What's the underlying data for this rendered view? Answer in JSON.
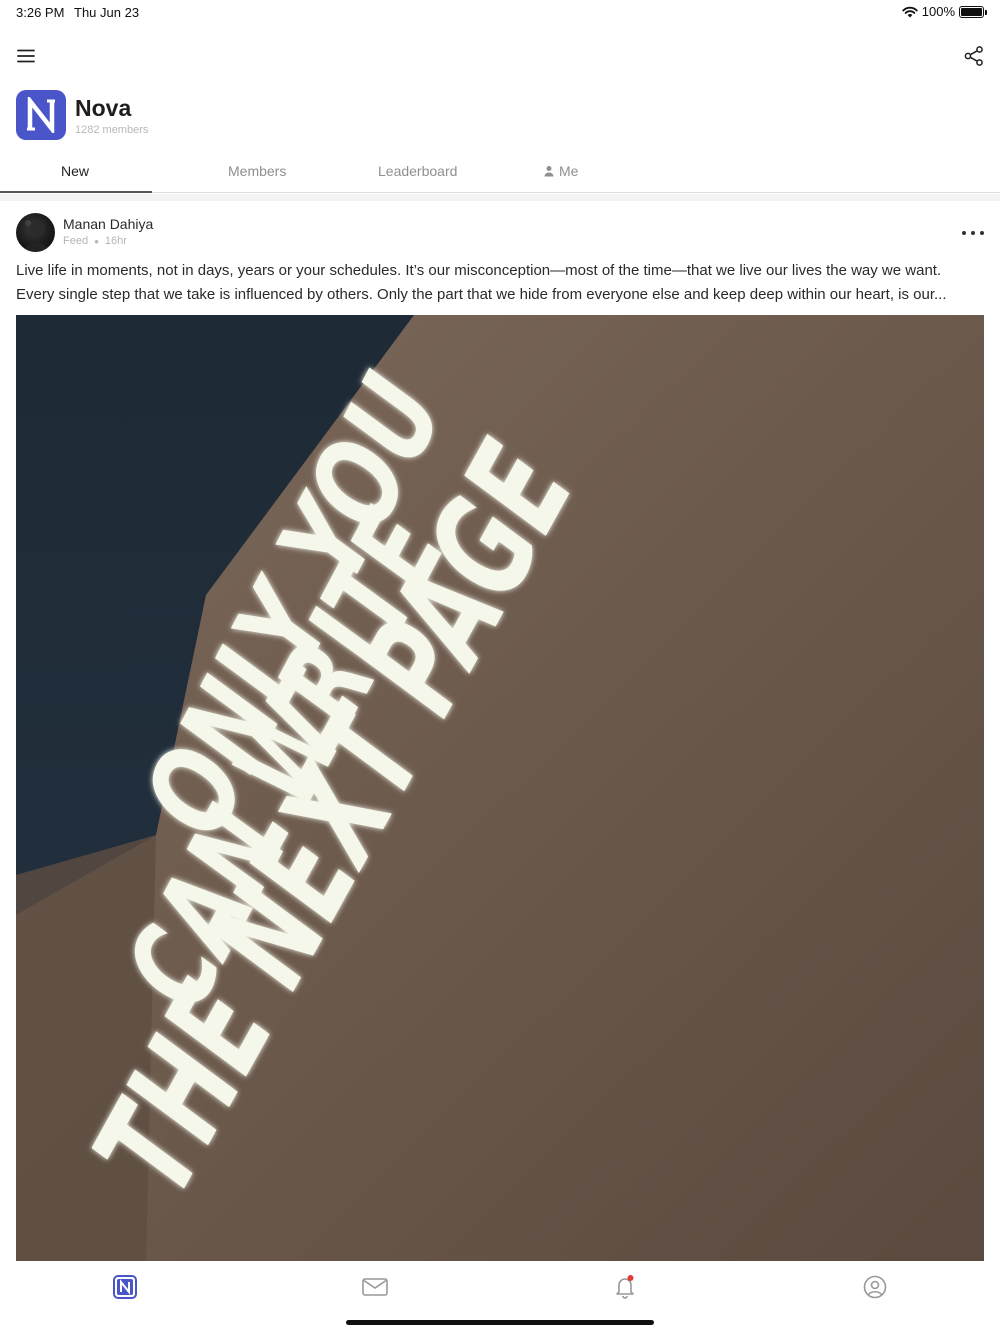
{
  "status_bar": {
    "time": "3:26 PM",
    "date": "Thu Jun 23",
    "battery": "100%",
    "battery_level": 1.0
  },
  "topbar": {
    "menu_icon": "hamburger-icon",
    "share_icon": "share-icon"
  },
  "group": {
    "logo_letter": "N",
    "name": "Nova",
    "members": "1282 members",
    "brand_color": "#4a55c9"
  },
  "tabs": [
    {
      "label": "New",
      "active": true
    },
    {
      "label": "Members",
      "active": false
    },
    {
      "label": "Leaderboard",
      "active": false
    },
    {
      "label": "Me",
      "active": false,
      "icon": "person-icon"
    }
  ],
  "post": {
    "author": "Manan Dahiya",
    "channel": "Feed",
    "time_ago": "16hr",
    "body_lines": [
      "Live life in moments, not in days, years or your schedules. It’s our misconception—most of the time—that we live our lives the way we want.",
      "Every single step that we take is influenced by others. Only the part that we hide from everyone else and keep deep within our heart, is our..."
    ],
    "image_text": [
      "ONLY YOU",
      "CAN WRITE",
      "THE NEXT PAGE"
    ]
  },
  "bottom_nav": [
    {
      "name": "home-tab",
      "icon": "nova-logo-icon",
      "active": true
    },
    {
      "name": "messages-tab",
      "icon": "mail-icon",
      "active": false
    },
    {
      "name": "notifications-tab",
      "icon": "bell-icon",
      "active": false,
      "badge": true
    },
    {
      "name": "profile-tab",
      "icon": "user-circle-icon",
      "active": false
    }
  ]
}
